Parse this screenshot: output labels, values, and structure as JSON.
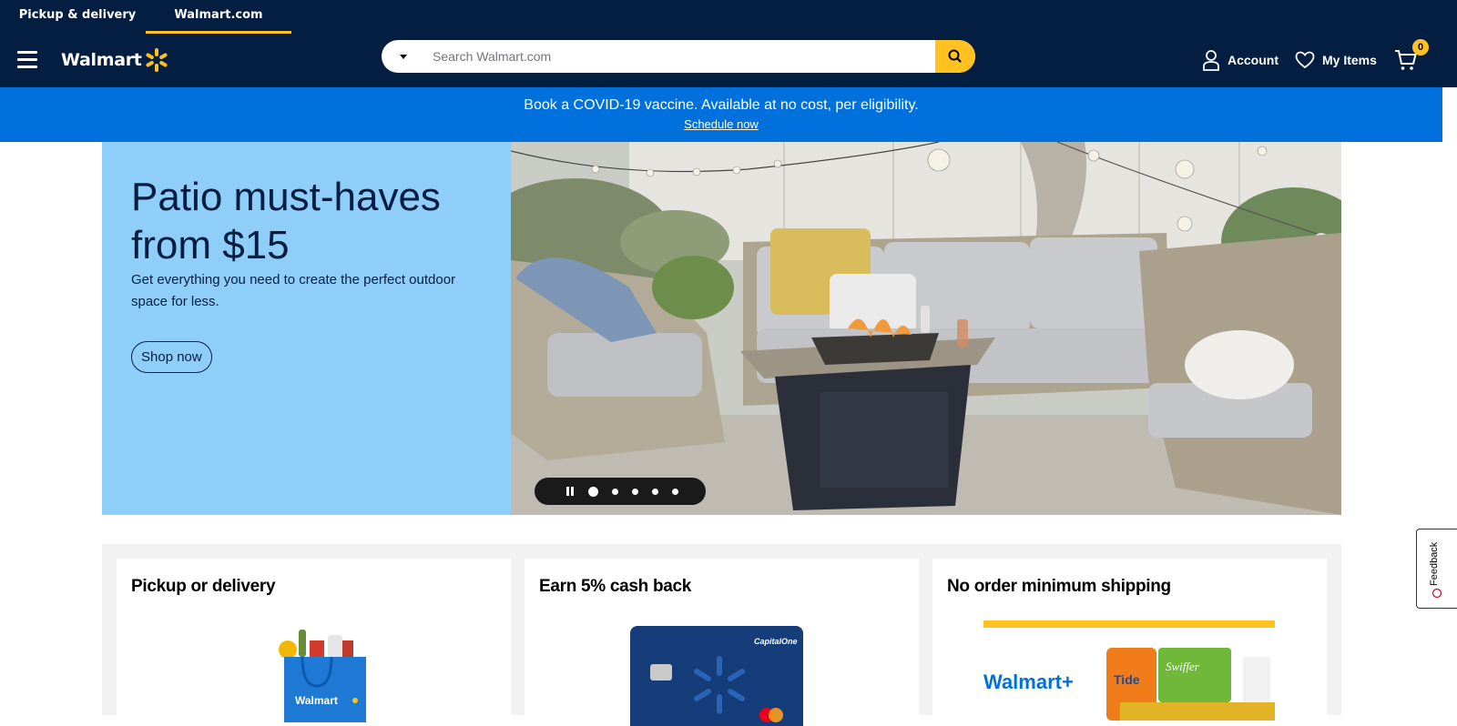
{
  "top_tabs": [
    {
      "label": "Pickup & delivery"
    },
    {
      "label": "Walmart.com"
    }
  ],
  "header": {
    "logo_text": "Walmart",
    "search_placeholder": "Search Walmart.com",
    "account_label": "Account",
    "my_items_label": "My Items",
    "cart_count": "0"
  },
  "banner": {
    "message": "Book a COVID-19 vaccine. Available at no cost, per eligibility.",
    "link": "Schedule now"
  },
  "hero": {
    "title": "Patio must-haves from $15",
    "subtitle": "Get everything you need to create the perfect outdoor space for less.",
    "cta": "Shop now",
    "carousel_slides": 5,
    "active_slide": 1
  },
  "cards": [
    {
      "title": "Pickup or delivery",
      "bag_text": "Walmart"
    },
    {
      "title": "Earn 5% cash back",
      "card_brand": "CapitalOne"
    },
    {
      "title": "No order minimum shipping",
      "brand": "Walmart+",
      "products": [
        "Tide",
        "Swiffer"
      ]
    }
  ],
  "feedback_label": "Feedback",
  "colors": {
    "navy": "#041e42",
    "blue": "#0071dc",
    "yellow": "#ffc220",
    "hero_bg": "#8fcef9"
  }
}
